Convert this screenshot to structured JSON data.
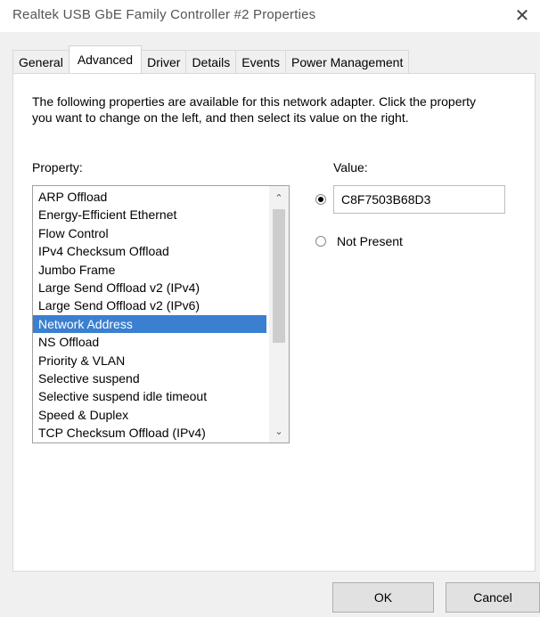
{
  "window": {
    "title": "Realtek USB GbE Family Controller #2 Properties",
    "close_glyph": "✕"
  },
  "tabs": [
    {
      "label": "General",
      "active": false
    },
    {
      "label": "Advanced",
      "active": true
    },
    {
      "label": "Driver",
      "active": false
    },
    {
      "label": "Details",
      "active": false
    },
    {
      "label": "Events",
      "active": false
    },
    {
      "label": "Power Management",
      "active": false
    }
  ],
  "advanced": {
    "description": "The following properties are available for this network adapter. Click the property you want to change on the left, and then select its value on the right.",
    "property_label": "Property:",
    "value_label": "Value:",
    "properties": [
      {
        "label": "ARP Offload"
      },
      {
        "label": "Energy-Efficient Ethernet"
      },
      {
        "label": "Flow Control"
      },
      {
        "label": "IPv4 Checksum Offload"
      },
      {
        "label": "Jumbo Frame"
      },
      {
        "label": "Large Send Offload v2 (IPv4)"
      },
      {
        "label": "Large Send Offload v2 (IPv6)"
      },
      {
        "label": "Network Address"
      },
      {
        "label": "NS Offload"
      },
      {
        "label": "Priority & VLAN"
      },
      {
        "label": "Selective suspend"
      },
      {
        "label": "Selective suspend idle timeout"
      },
      {
        "label": "Speed & Duplex"
      },
      {
        "label": "TCP Checksum Offload (IPv4)"
      }
    ],
    "selected_property": "Network Address",
    "value_input": "C8F7503B68D3",
    "value_option_selected": "value",
    "not_present_label": "Not Present",
    "scroll_up_glyph": "⌃",
    "scroll_down_glyph": "⌄"
  },
  "buttons": {
    "ok": "OK",
    "cancel": "Cancel"
  },
  "colors": {
    "selection": "#3a7fd0"
  }
}
